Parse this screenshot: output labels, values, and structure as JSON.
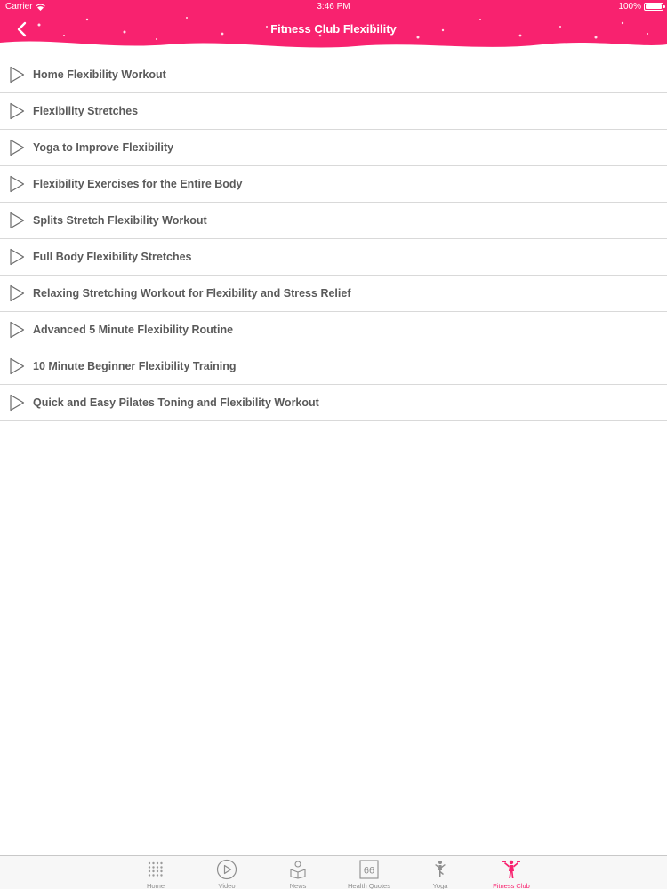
{
  "status_bar": {
    "carrier": "Carrier",
    "time": "3:46 PM",
    "battery": "100%"
  },
  "header": {
    "title": "Fitness Club Flexibility",
    "back_icon": "chevron-left-icon",
    "background_color": "#f8226f"
  },
  "videos": [
    {
      "title": "Home Flexibility Workout"
    },
    {
      "title": "Flexibility Stretches"
    },
    {
      "title": "Yoga to Improve Flexibility"
    },
    {
      "title": "Flexibility Exercises for the Entire Body"
    },
    {
      "title": "Splits Stretch Flexibility Workout"
    },
    {
      "title": "Full Body Flexibility Stretches"
    },
    {
      "title": "Relaxing Stretching Workout for Flexibility and Stress Relief"
    },
    {
      "title": "Advanced 5 Minute Flexibility Routine"
    },
    {
      "title": "10 Minute Beginner Flexibility Training"
    },
    {
      "title": "Quick and Easy Pilates Toning and Flexibility Workout"
    }
  ],
  "tab_bar": {
    "active_color": "#f8226f",
    "inactive_color": "#8e8e8e",
    "tabs": [
      {
        "label": "Home",
        "icon": "dot-grid-icon",
        "active": false
      },
      {
        "label": "Video",
        "icon": "play-circle-icon",
        "active": false
      },
      {
        "label": "News",
        "icon": "news-icon",
        "active": false
      },
      {
        "label": "Health Quotes",
        "icon": "quote-icon",
        "active": false
      },
      {
        "label": "Yoga",
        "icon": "yoga-pose-icon",
        "active": false
      },
      {
        "label": "Fitness Club",
        "icon": "fitness-icon",
        "active": true
      }
    ]
  }
}
